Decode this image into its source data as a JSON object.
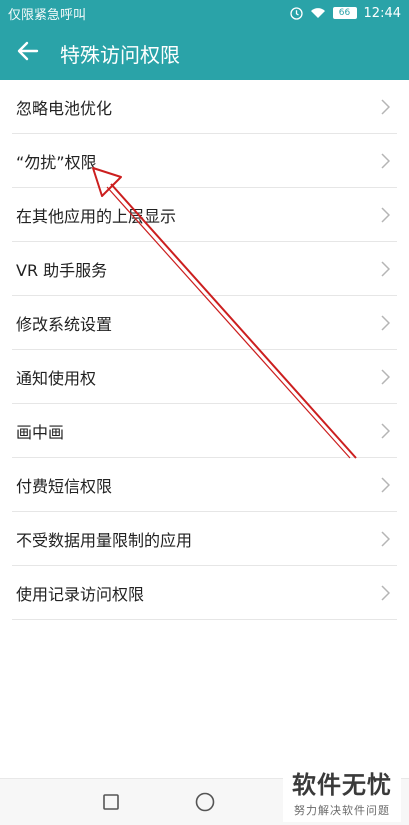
{
  "status_bar": {
    "carrier_text": "仅限紧急呼叫",
    "battery_level": "66",
    "time": "12:44",
    "icons": [
      "dnd-icon",
      "wifi-icon",
      "battery-icon"
    ]
  },
  "header": {
    "back_icon": "back-arrow-icon",
    "title": "特殊访问权限",
    "color": "#2aa3a8"
  },
  "list": {
    "items": [
      {
        "label": "忽略电池优化"
      },
      {
        "label": "“勿扰”权限"
      },
      {
        "label": "在其他应用的上层显示"
      },
      {
        "label": "VR 助手服务"
      },
      {
        "label": "修改系统设置"
      },
      {
        "label": "通知使用权"
      },
      {
        "label": "画中画"
      },
      {
        "label": "付费短信权限"
      },
      {
        "label": "不受数据用量限制的应用"
      },
      {
        "label": "使用记录访问权限"
      }
    ],
    "chevron_icon": "chevron-right-icon"
  },
  "annotation": {
    "type": "red-arrow",
    "target": "“勿扰”权限",
    "color": "#cc1f1f"
  },
  "nav_bar": {
    "icons": [
      "recents-square-icon",
      "home-circle-icon"
    ]
  },
  "watermark": {
    "title": "软件无忧",
    "subtitle": "努力解决软件问题"
  }
}
